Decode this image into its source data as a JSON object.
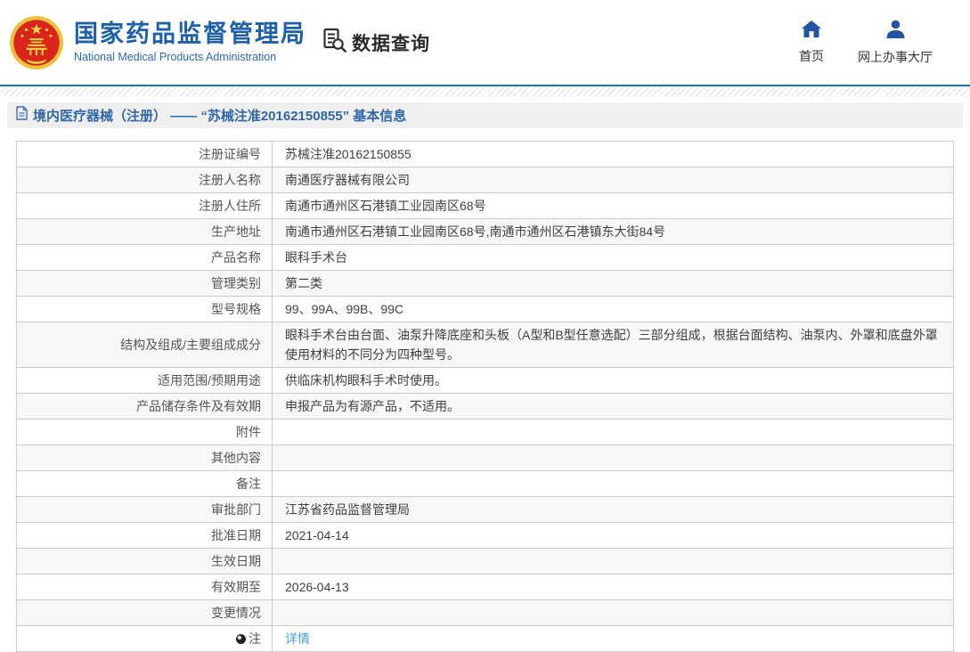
{
  "header": {
    "brand_title": "国家药品监督管理局",
    "brand_subtitle": "National Medical Products Administration",
    "data_query_label": "数据查询",
    "nav": [
      {
        "label": "首页",
        "icon": "home-icon"
      },
      {
        "label": "网上办事大厅",
        "icon": "user-icon"
      }
    ]
  },
  "page": {
    "title": "境内医疗器械（注册） —— “苏械注准20162150855” 基本信息"
  },
  "table": {
    "rows": [
      {
        "label": "注册证编号",
        "value": "苏械注准20162150855"
      },
      {
        "label": "注册人名称",
        "value": "南通医疗器械有限公司"
      },
      {
        "label": "注册人住所",
        "value": "南通市通州区石港镇工业园南区68号"
      },
      {
        "label": "生产地址",
        "value": "南通市通州区石港镇工业园南区68号,南通市通州区石港镇东大街84号"
      },
      {
        "label": "产品名称",
        "value": "眼科手术台"
      },
      {
        "label": "管理类别",
        "value": "第二类"
      },
      {
        "label": "型号规格",
        "value": "99、99A、99B、99C"
      },
      {
        "label": "结构及组成/主要组成成分",
        "value": "眼科手术台由台面、油泵升降底座和头板（A型和B型任意选配）三部分组成，根据台面结构、油泵内、外罩和底盘外罩使用材料的不同分为四种型号。"
      },
      {
        "label": "适用范围/预期用途",
        "value": "供临床机构眼科手术时使用。"
      },
      {
        "label": "产品储存条件及有效期",
        "value": "申报产品为有源产品，不适用。"
      },
      {
        "label": "附件",
        "value": ""
      },
      {
        "label": "其他内容",
        "value": ""
      },
      {
        "label": "备注",
        "value": ""
      },
      {
        "label": "审批部门",
        "value": "江苏省药品监督管理局"
      },
      {
        "label": "批准日期",
        "value": "2021-04-14"
      },
      {
        "label": "生效日期",
        "value": ""
      },
      {
        "label": "有效期至",
        "value": "2026-04-13"
      },
      {
        "label": "变更情况",
        "value": ""
      },
      {
        "label": "注",
        "value": "详情",
        "icon": "note-icon",
        "value_is_link": true
      }
    ]
  },
  "colors": {
    "brand_blue": "#1c61aa",
    "accent_blue": "#2270b7",
    "nav_icon_blue": "#2355a4",
    "link_blue": "#41a1e0",
    "title_bar_bg": "#efefef",
    "row_alt_bg": "#f7f7f7",
    "table_border": "#cccccc",
    "emblem_red": "#da251c",
    "emblem_gold": "#f7d74a"
  }
}
